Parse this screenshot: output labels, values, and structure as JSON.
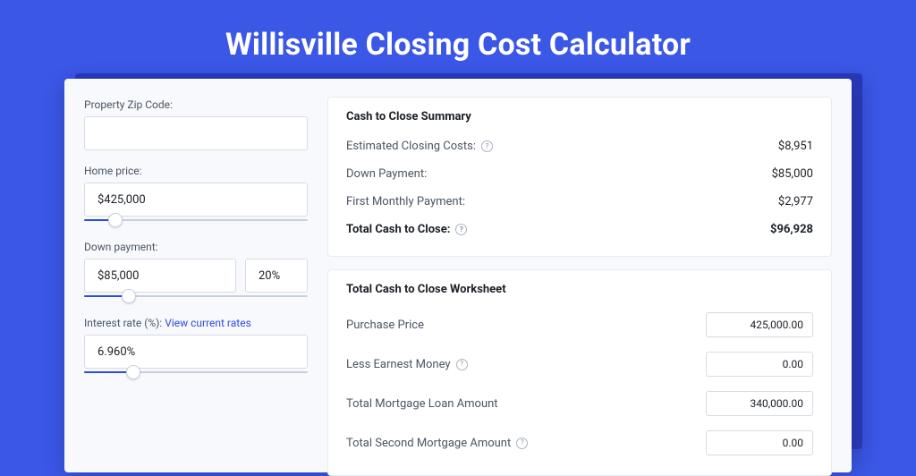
{
  "page": {
    "title": "Willisville Closing Cost Calculator"
  },
  "sidebar": {
    "zip": {
      "label": "Property Zip Code:",
      "value": ""
    },
    "home_price": {
      "label": "Home price:",
      "value": "$425,000",
      "slider_pct": 14
    },
    "down": {
      "label": "Down payment:",
      "value": "$85,000",
      "pct": "20%",
      "slider_pct": 20
    },
    "rate": {
      "label": "Interest rate (%):",
      "link_text": "View current rates",
      "value": "6.960%",
      "slider_pct": 22
    }
  },
  "summary": {
    "heading": "Cash to Close Summary",
    "rows": [
      {
        "label": "Estimated Closing Costs:",
        "help": true,
        "value": "$8,951"
      },
      {
        "label": "Down Payment:",
        "help": false,
        "value": "$85,000"
      },
      {
        "label": "First Monthly Payment:",
        "help": false,
        "value": "$2,977"
      }
    ],
    "total": {
      "label": "Total Cash to Close:",
      "help": true,
      "value": "$96,928"
    }
  },
  "worksheet": {
    "heading": "Total Cash to Close Worksheet",
    "rows": [
      {
        "label": "Purchase Price",
        "help": false,
        "value": "425,000.00"
      },
      {
        "label": "Less Earnest Money",
        "help": true,
        "value": "0.00"
      },
      {
        "label": "Total Mortgage Loan Amount",
        "help": false,
        "value": "340,000.00"
      },
      {
        "label": "Total Second Mortgage Amount",
        "help": true,
        "value": "0.00"
      }
    ]
  }
}
